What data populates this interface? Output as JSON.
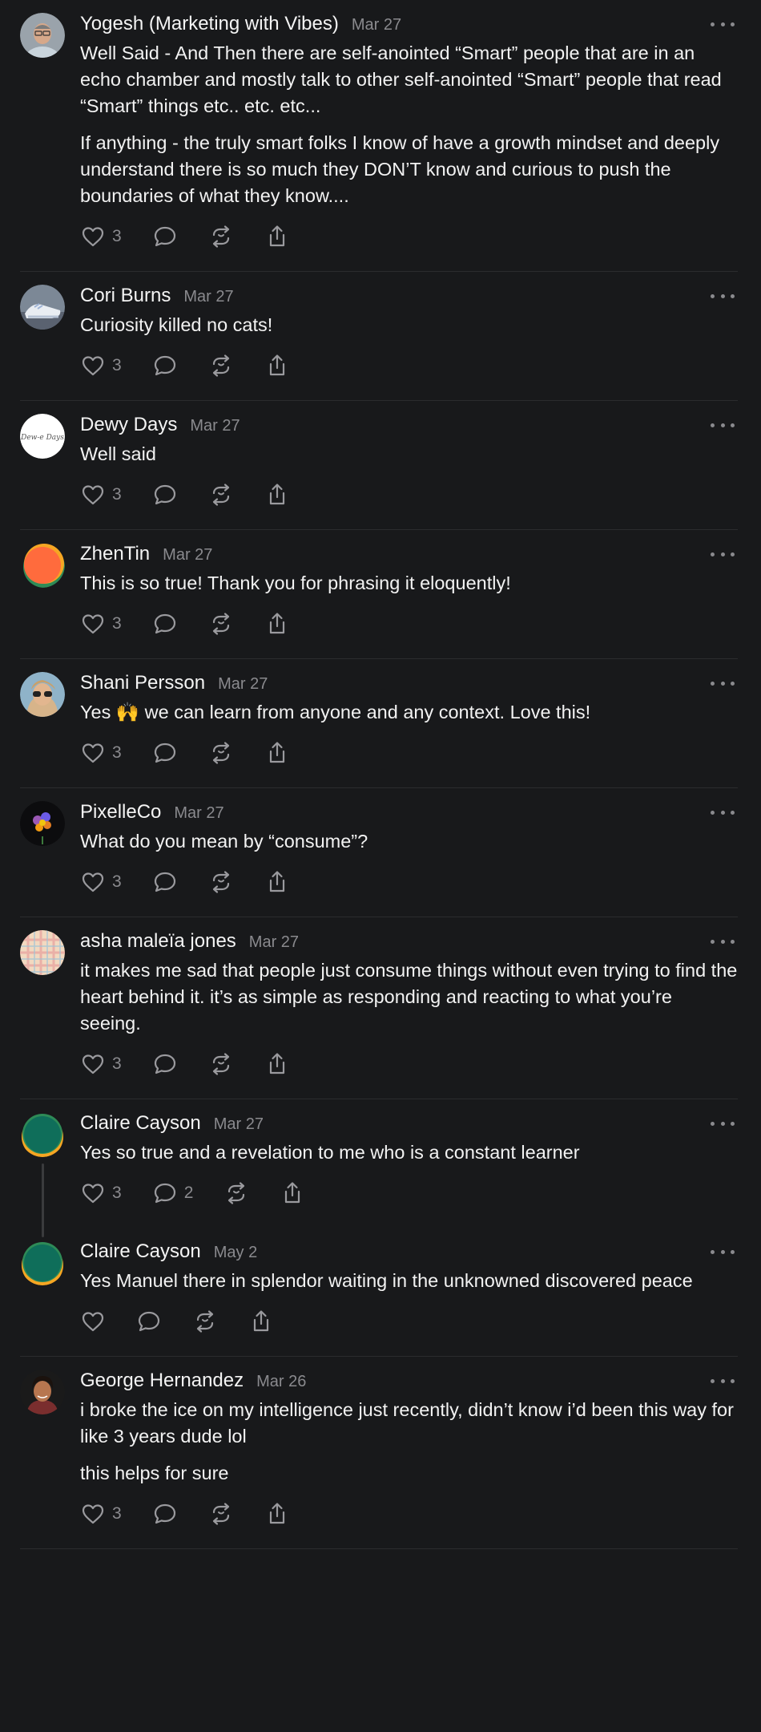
{
  "replies": [
    {
      "name": "Yogesh (Marketing with Vibes)",
      "date": "Mar 27",
      "avatar": "portrait-man-glasses",
      "paragraphs": [
        "Well Said - And Then there are self-anointed “Smart” people that are in an echo chamber and mostly talk to other self-anointed “Smart” people that read “Smart” things etc.. etc. etc...",
        "If anything - the truly smart folks I know of have a growth mindset and deeply understand there is so much they DON’T know and curious to push the boundaries of what they know...."
      ],
      "likes": "3",
      "comments": ""
    },
    {
      "name": "Cori Burns",
      "date": "Mar 27",
      "avatar": "sneakers-photo",
      "paragraphs": [
        "Curiosity killed no cats!"
      ],
      "likes": "3",
      "comments": ""
    },
    {
      "name": "Dewy Days",
      "date": "Mar 27",
      "avatar": "script-logo-white",
      "avatar_text": "Dew-e Days",
      "paragraphs": [
        "Well said"
      ],
      "likes": "3",
      "comments": ""
    },
    {
      "name": "ZhenTin",
      "date": "Mar 27",
      "avatar": "orange-green-circle",
      "paragraphs": [
        "This is so true! Thank you for phrasing it eloquently!"
      ],
      "likes": "3",
      "comments": ""
    },
    {
      "name": "Shani Persson",
      "date": "Mar 27",
      "avatar": "portrait-woman-sunglasses",
      "paragraphs": [
        "Yes 🙌 we can learn from anyone and any context. Love this!"
      ],
      "likes": "3",
      "comments": ""
    },
    {
      "name": "PixelleCo",
      "date": "Mar 27",
      "avatar": "flower-dark",
      "paragraphs": [
        "What do you mean by “consume”?"
      ],
      "likes": "3",
      "comments": ""
    },
    {
      "name": "asha maleïa jones",
      "date": "Mar 27",
      "avatar": "plaid-pattern",
      "paragraphs": [
        "it makes me sad that people just consume things without even trying to find the heart behind it. it’s as simple as responding and reacting to what you’re seeing."
      ],
      "likes": "3",
      "comments": ""
    },
    {
      "name": "Claire Cayson",
      "date": "Mar 27",
      "avatar": "teal-orange-circle",
      "paragraphs": [
        "Yes so true and a revelation to me who is a constant learner"
      ],
      "likes": "3",
      "comments": "2",
      "threaded": true
    },
    {
      "name": "Claire Cayson",
      "date": "May 2",
      "avatar": "teal-orange-circle",
      "paragraphs": [
        "Yes Manuel there in splendor waiting in the unknowned discovered peace"
      ],
      "likes": "",
      "comments": ""
    },
    {
      "name": "George Hernandez",
      "date": "Mar 26",
      "avatar": "portrait-man-dark",
      "paragraphs": [
        "i broke the ice on my intelligence just recently, didn’t know i’d been this way for like 3 years dude lol",
        "this helps for sure"
      ],
      "likes": "3",
      "comments": ""
    }
  ],
  "icons": {
    "like": "heart-icon",
    "comment": "comment-bubble-icon",
    "repost": "repost-arrows-icon",
    "share": "share-upload-icon",
    "more": "more-options-icon"
  },
  "colors": {
    "background": "#18191b",
    "text": "#f2f2f2",
    "muted": "#8a8a8e",
    "divider": "#2b2c2e"
  }
}
